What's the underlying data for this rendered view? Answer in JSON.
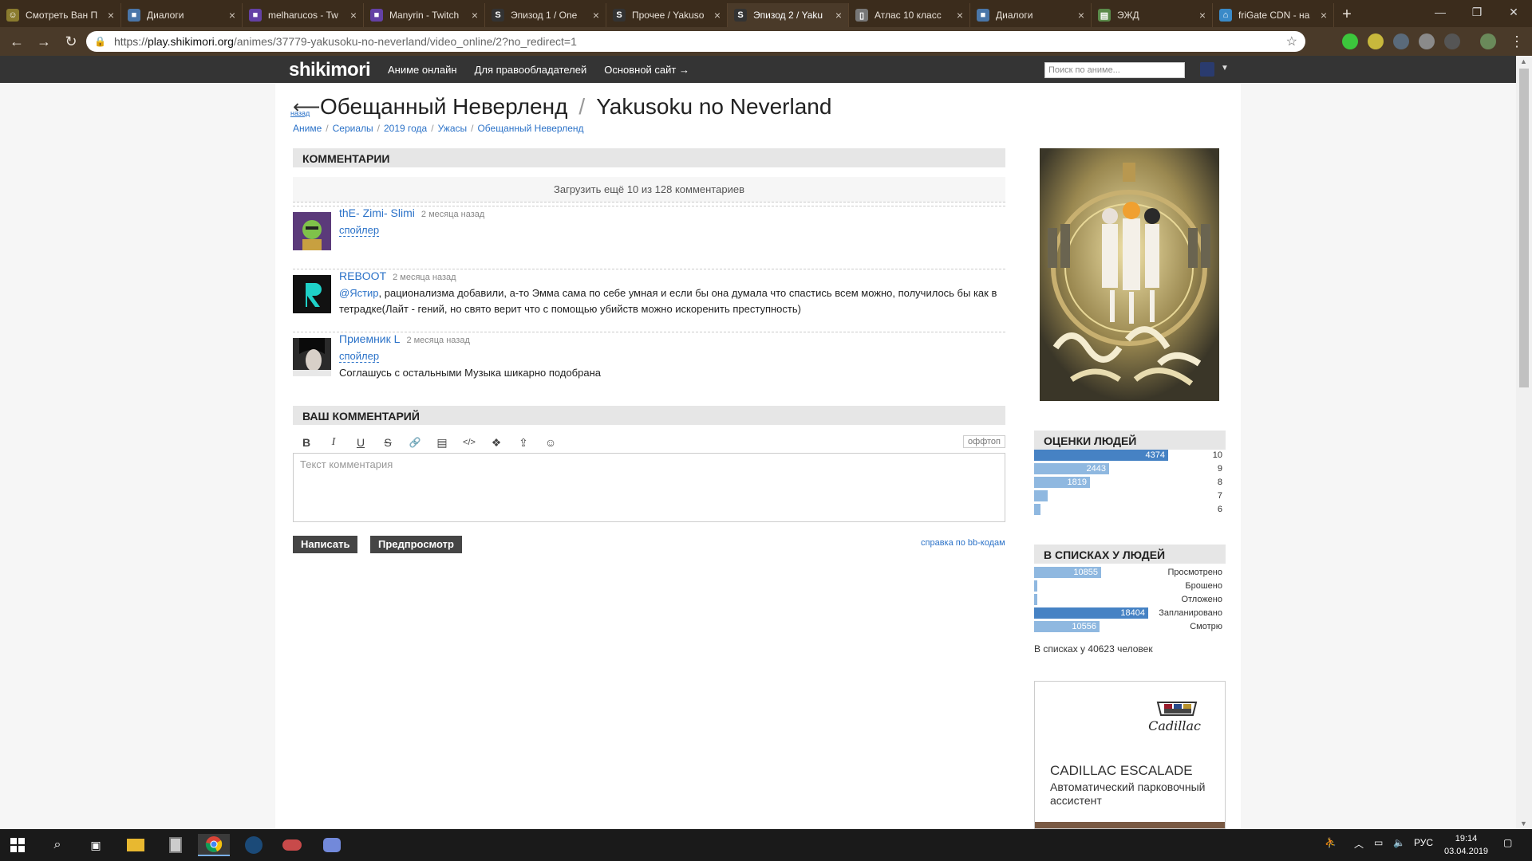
{
  "browser": {
    "tabs": [
      {
        "label": "Смотреть Ван П",
        "color": "#8a7b2e",
        "glyph": "☺",
        "active": false
      },
      {
        "label": "Диалоги",
        "color": "#4a76a8",
        "glyph": "■",
        "active": false
      },
      {
        "label": "melharucos - Tw",
        "color": "#6441a5",
        "glyph": "■",
        "active": false
      },
      {
        "label": "Manyrin - Twitch",
        "color": "#6441a5",
        "glyph": "■",
        "active": false
      },
      {
        "label": "Эпизод 1 / One",
        "color": "#333333",
        "glyph": "S",
        "active": false
      },
      {
        "label": "Прочее / Yakusо",
        "color": "#333333",
        "glyph": "S",
        "active": false
      },
      {
        "label": "Эпизод 2 / Yaku",
        "color": "#333333",
        "glyph": "S",
        "active": true
      },
      {
        "label": "Атлас 10 класс",
        "color": "#777777",
        "glyph": "▯",
        "active": false
      },
      {
        "label": "Диалоги",
        "color": "#4a76a8",
        "glyph": "■",
        "active": false
      },
      {
        "label": "ЭЖД",
        "color": "#5a8a4a",
        "glyph": "▤",
        "active": false
      },
      {
        "label": "friGate CDN - на",
        "color": "#3a8ac8",
        "glyph": "⌂",
        "active": false
      }
    ],
    "close_glyph": "×",
    "newtab_glyph": "+",
    "window_controls": [
      "—",
      "❐",
      "✕"
    ],
    "url": {
      "scheme": "https://",
      "host": "play.shikimori.org",
      "path": "/animes/37779-yakusoku-no-neverland/video_online/2?no_redirect=1"
    }
  },
  "site": {
    "logo": "shikimori",
    "nav": [
      "Аниме онлайн",
      "Для правообладателей",
      "Основной сайт →"
    ],
    "search_placeholder": "Поиск по аниме..."
  },
  "page": {
    "back_label": "назад",
    "title_ru": "Обещанный Неверленд",
    "title_sep": "/",
    "title_en": "Yakusoku no Neverland",
    "breadcrumbs": [
      "Аниме",
      "Сериалы",
      "2019 года",
      "Ужасы",
      "Обещанный Неверленд"
    ]
  },
  "comments": {
    "header": "Комментарии",
    "load_more": "Загрузить ещё 10 из 128 комментариев",
    "items": [
      {
        "name": "thE- Zimi- Slimi",
        "time": "2 месяца назад",
        "spoiler": "спойлер",
        "text": ""
      },
      {
        "name": "REBOOT",
        "time": "2 месяца назад",
        "spoiler": "",
        "mention": "@Ястир",
        "text": ", рационализма добавили, а-то Эмма сама по себе умная и если бы она думала что спастись всем можно, получилось бы как в тетрадке(Лайт - гений, но свято верит что с помощью убийств можно искоренить преступность)"
      },
      {
        "name": "Приемник L",
        "time": "2 месяца назад",
        "spoiler": "спойлер",
        "text": "Соглашусь с остальными Музыка шикарно подобрана"
      }
    ]
  },
  "editor": {
    "header": "Ваш комментарий",
    "tools": [
      "B",
      "I",
      "U",
      "S",
      "🔗",
      "▤",
      "</>",
      "❖",
      "⇪",
      "☺"
    ],
    "offtopic": "оффтоп",
    "placeholder": "Текст комментария",
    "submit": "Написать",
    "preview": "Предпросмотр",
    "bbhelp": "справка по bb-кодам"
  },
  "ratings": {
    "header": "Оценки людей",
    "max": 4374,
    "rows": [
      {
        "score": "10",
        "count": 4374,
        "label": "4374"
      },
      {
        "score": "9",
        "count": 2443,
        "label": "2443"
      },
      {
        "score": "8",
        "count": 1819,
        "label": "1819"
      },
      {
        "score": "7",
        "count": 450,
        "label": ""
      },
      {
        "score": "6",
        "count": 140,
        "label": ""
      }
    ]
  },
  "lists": {
    "header": "В списках у людей",
    "max": 18404,
    "rows": [
      {
        "status": "Просмотрено",
        "count": 10855,
        "label": "10855"
      },
      {
        "status": "Брошено",
        "count": 160,
        "label": ""
      },
      {
        "status": "Отложено",
        "count": 120,
        "label": ""
      },
      {
        "status": "Запланировано",
        "count": 18404,
        "label": "18404"
      },
      {
        "status": "Смотрю",
        "count": 10556,
        "label": "10556"
      }
    ],
    "summary": "В списках у 40623 человек"
  },
  "ad": {
    "brand": "Cadillac",
    "model": "CADILLAC ESCALADE",
    "text": "Автоматический парковочный ассистент"
  },
  "taskbar": {
    "lang": "РУС",
    "time": "19:14",
    "date": "03.04.2019"
  },
  "colors": {
    "link": "#2b72c8",
    "bar_dark": "#4682c4",
    "bar_light": "#8fb8e0"
  }
}
